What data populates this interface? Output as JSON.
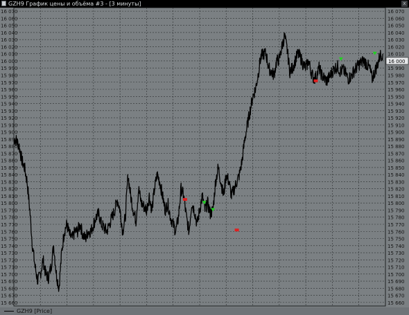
{
  "window": {
    "title": "GZH9 График цены и объёма #3 - [3 минуты]",
    "close_label": "x"
  },
  "legend": {
    "label": "GZH9 [Price]"
  },
  "chart_data": {
    "type": "line",
    "series": [
      {
        "name": "GZH9 [Price]",
        "color": "#000000",
        "x": [
          0,
          4,
          8,
          12,
          16,
          20,
          24,
          28,
          32,
          36,
          40,
          44,
          48,
          52,
          56,
          60,
          64,
          68,
          72,
          76,
          80,
          84,
          88,
          92,
          96,
          100,
          104,
          108,
          112,
          116,
          120,
          124,
          128,
          132,
          136,
          140,
          144,
          148,
          152,
          156,
          160,
          164,
          168,
          172,
          176,
          180,
          184,
          188,
          192,
          196,
          200,
          204,
          208,
          212,
          216,
          220,
          224,
          228,
          232,
          236,
          240,
          244,
          248,
          252,
          256,
          260,
          264,
          268,
          272,
          276,
          280,
          284,
          288,
          292,
          296,
          300,
          304,
          308,
          312,
          316,
          320,
          324,
          328,
          332,
          336,
          340,
          344,
          348,
          352,
          356,
          360,
          364,
          368,
          372,
          376,
          380,
          384,
          388,
          392,
          396,
          400,
          404,
          408,
          412,
          416,
          420,
          424,
          428,
          432,
          436,
          440,
          444,
          448,
          452,
          456,
          460,
          464,
          468,
          472,
          476,
          480,
          484,
          488,
          492,
          496,
          500,
          504,
          508,
          512,
          516,
          520,
          524,
          528,
          532,
          536,
          540,
          544,
          548,
          552,
          556
        ],
        "y": [
          15890,
          15888,
          15880,
          15860,
          15850,
          15830,
          15790,
          15740,
          15710,
          15690,
          15700,
          15720,
          15700,
          15695,
          15710,
          15740,
          15700,
          15680,
          15730,
          15760,
          15770,
          15755,
          15750,
          15760,
          15760,
          15770,
          15755,
          15750,
          15760,
          15760,
          15770,
          15780,
          15785,
          15770,
          15765,
          15760,
          15770,
          15780,
          15790,
          15805,
          15790,
          15760,
          15780,
          15840,
          15810,
          15790,
          15775,
          15820,
          15800,
          15795,
          15790,
          15810,
          15790,
          15820,
          15840,
          15830,
          15810,
          15790,
          15800,
          15780,
          15770,
          15760,
          15780,
          15820,
          15810,
          15780,
          15760,
          15800,
          15790,
          15770,
          15790,
          15810,
          15790,
          15800,
          15785,
          15790,
          15830,
          15850,
          15830,
          15810,
          15840,
          15830,
          15810,
          15820,
          15830,
          15840,
          15860,
          15890,
          15910,
          15930,
          15950,
          15960,
          15980,
          16005,
          16010,
          16010,
          15990,
          15985,
          15980,
          16000,
          16002,
          16020,
          16035,
          16015,
          15985,
          15990,
          16000,
          16010,
          16005,
          15995,
          15990,
          16000,
          15985,
          15975,
          15978,
          15990,
          15980,
          15975,
          15972,
          15978,
          15985,
          15990,
          15992,
          15985,
          15988,
          15982,
          15975,
          15978,
          15985,
          15990,
          15995,
          15998,
          16000,
          15995,
          15990,
          15975,
          15985,
          15995,
          16008,
          16010
        ],
        "color_markers_up": "#22d022",
        "color_markers_down": "#e02020"
      }
    ],
    "markers": [
      {
        "x": 258,
        "y": 15805,
        "side": "sell",
        "color": "#e02020"
      },
      {
        "x": 287,
        "y": 15800,
        "side": "buy",
        "color": "#22d022"
      },
      {
        "x": 300,
        "y": 15790,
        "side": "buy",
        "color": "#22d022"
      },
      {
        "x": 336,
        "y": 15762,
        "side": "sell",
        "color": "#e02020"
      },
      {
        "x": 455,
        "y": 15972,
        "side": "sell",
        "color": "#e02020"
      },
      {
        "x": 493,
        "y": 16002,
        "side": "buy",
        "color": "#22d022"
      },
      {
        "x": 544,
        "y": 16010,
        "side": "buy",
        "color": "#22d022"
      }
    ],
    "y_ticks_left": [
      "16 070",
      "16 060",
      "16 050",
      "16 040",
      "16 030",
      "16 020",
      "16 010",
      "16 000",
      "15 990",
      "15 980",
      "15 970",
      "15 960",
      "15 950",
      "15 940",
      "15 930",
      "15 920",
      "15 910",
      "15 900",
      "15 890",
      "15 880",
      "15 870",
      "15 860",
      "15 850",
      "15 840",
      "15 830",
      "15 820",
      "15 810",
      "15 800",
      "15 790",
      "15 780",
      "15 770",
      "15 760",
      "15 750",
      "15 740",
      "15 730",
      "15 720",
      "15 710",
      "15 700",
      "15 690",
      "15 680",
      "15 670",
      "15 660"
    ],
    "y_ticks_right": [
      "16 070",
      "16 060",
      "16 050",
      "16 040",
      "16 030",
      "16 020",
      "16 010",
      "16 000",
      "15 990",
      "15 980",
      "15 970",
      "15 960",
      "15 950",
      "15 940",
      "15 930",
      "15 920",
      "15 910",
      "15 900",
      "15 890",
      "15 880",
      "15 870",
      "15 860",
      "15 850",
      "15 840",
      "15 830",
      "15 820",
      "15 810",
      "15 800",
      "15 790",
      "15 780",
      "15 770",
      "15 760",
      "15 750",
      "15 740",
      "15 730",
      "15 720",
      "15 710",
      "15 700",
      "15 690",
      "15 680",
      "15 670",
      "15 660"
    ],
    "last_price_label": "16 000",
    "last_price": 16000,
    "ylim": [
      15655,
      16075
    ],
    "xlim": [
      0,
      560
    ],
    "grid": true,
    "colors": {
      "plot_bg": "#7b8083",
      "grid": "#2c2f31",
      "text": "#141414",
      "line": "#000000"
    }
  }
}
